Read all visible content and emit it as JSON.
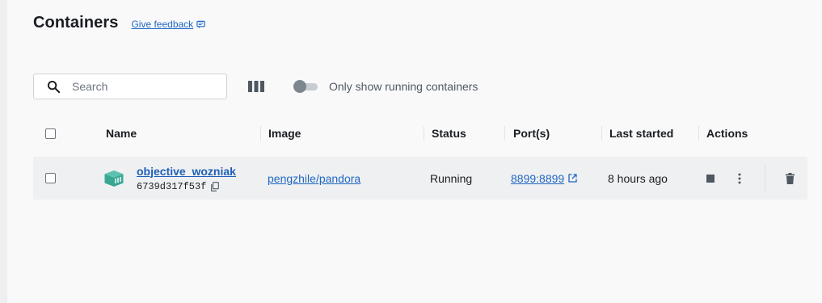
{
  "page": {
    "title": "Containers",
    "feedback_label": "Give feedback"
  },
  "toolbar": {
    "search_placeholder": "Search",
    "toggle_label": "Only show running containers",
    "toggle_on": false
  },
  "table": {
    "columns": [
      "Name",
      "Image",
      "Status",
      "Port(s)",
      "Last started",
      "Actions"
    ],
    "rows": [
      {
        "name": "objective_wozniak",
        "id": "6739d317f53f",
        "image": "pengzhile/pandora",
        "status": "Running",
        "ports": "8899:8899",
        "last_started": "8 hours ago"
      }
    ]
  },
  "colors": {
    "accent": "#1f67c2",
    "container_icon": "#3aa796",
    "row_background": "#eff0f2"
  }
}
